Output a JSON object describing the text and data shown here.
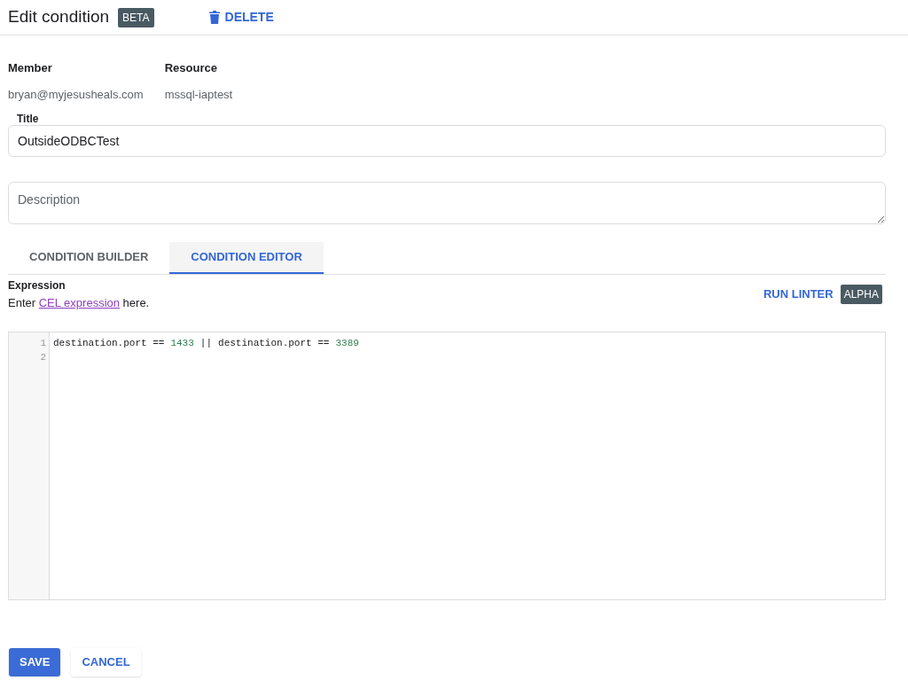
{
  "header": {
    "title": "Edit condition",
    "badge": "BETA",
    "delete_label": "DELETE"
  },
  "info": [
    {
      "label": "Member",
      "value": "bryan@myjesusheals.com"
    },
    {
      "label": "Resource",
      "value": "mssql-iaptest"
    }
  ],
  "title_field": {
    "label": "Title",
    "value": "OutsideODBCTest"
  },
  "description_field": {
    "placeholder": "Description"
  },
  "tabs": [
    {
      "label": "CONDITION BUILDER",
      "selected": false
    },
    {
      "label": "CONDITION EDITOR",
      "selected": true
    }
  ],
  "expression": {
    "heading": "Expression",
    "hint_before": "Enter",
    "hint_link": "CEL expression",
    "hint_after": "here.",
    "linter_label": "RUN LINTER",
    "linter_badge": "ALPHA"
  },
  "editor": {
    "lines": [
      {
        "number": "1",
        "tokens": [
          {
            "text": "destination.port ==",
            "kind": "code"
          },
          {
            "text": "1433",
            "kind": "number"
          },
          {
            "text": "||",
            "kind": "code"
          },
          {
            "text": "destination.port ==",
            "kind": "code"
          },
          {
            "text": "3389",
            "kind": "number"
          }
        ]
      },
      {
        "number": "2"
      }
    ]
  },
  "buttons": [
    {
      "label": "SAVE",
      "kind": "primary"
    },
    {
      "label": "CANCEL",
      "kind": "secondary"
    }
  ]
}
